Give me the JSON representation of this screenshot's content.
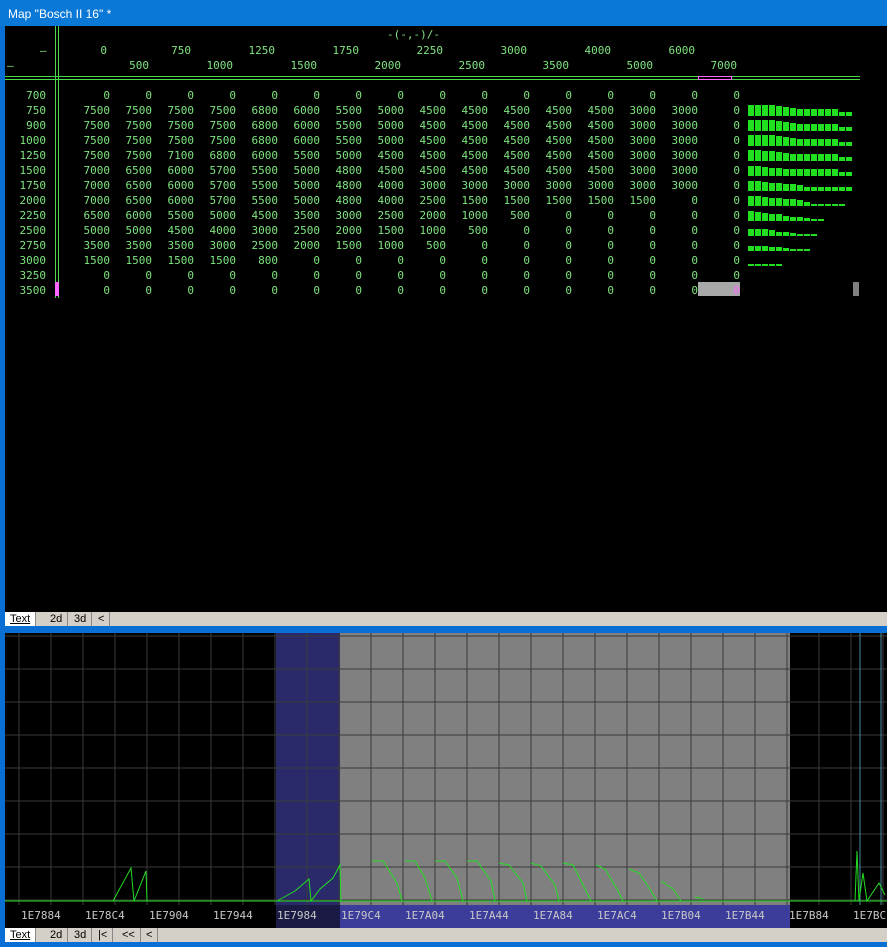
{
  "window": {
    "title": "Map \"Bosch II 16\" *"
  },
  "map": {
    "axis_label": "-(-,-)/-",
    "corner_top": "–",
    "corner_bottom": "–",
    "x_axis": [
      "0",
      "500",
      "750",
      "1000",
      "1250",
      "1500",
      "1750",
      "2000",
      "2250",
      "2500",
      "3000",
      "3500",
      "4000",
      "5000",
      "6000",
      "7000"
    ],
    "y_axis": [
      "700",
      "750",
      "900",
      "1000",
      "1250",
      "1500",
      "1750",
      "2000",
      "2250",
      "2500",
      "2750",
      "3000",
      "3250",
      "3500"
    ],
    "rows": [
      [
        "0",
        "0",
        "0",
        "0",
        "0",
        "0",
        "0",
        "0",
        "0",
        "0",
        "0",
        "0",
        "0",
        "0",
        "0",
        "0"
      ],
      [
        "7500",
        "7500",
        "7500",
        "7500",
        "6800",
        "6000",
        "5500",
        "5000",
        "4500",
        "4500",
        "4500",
        "4500",
        "4500",
        "3000",
        "3000",
        "0"
      ],
      [
        "7500",
        "7500",
        "7500",
        "7500",
        "6800",
        "6000",
        "5500",
        "5000",
        "4500",
        "4500",
        "4500",
        "4500",
        "4500",
        "3000",
        "3000",
        "0"
      ],
      [
        "7500",
        "7500",
        "7500",
        "7500",
        "6800",
        "6000",
        "5500",
        "5000",
        "4500",
        "4500",
        "4500",
        "4500",
        "4500",
        "3000",
        "3000",
        "0"
      ],
      [
        "7500",
        "7500",
        "7100",
        "6800",
        "6000",
        "5500",
        "5000",
        "4500",
        "4500",
        "4500",
        "4500",
        "4500",
        "4500",
        "3000",
        "3000",
        "0"
      ],
      [
        "7000",
        "6500",
        "6000",
        "5700",
        "5500",
        "5000",
        "4800",
        "4500",
        "4500",
        "4500",
        "4500",
        "4500",
        "4500",
        "3000",
        "3000",
        "0"
      ],
      [
        "7000",
        "6500",
        "6000",
        "5700",
        "5500",
        "5000",
        "4800",
        "4000",
        "3000",
        "3000",
        "3000",
        "3000",
        "3000",
        "3000",
        "3000",
        "0"
      ],
      [
        "7000",
        "6500",
        "6000",
        "5700",
        "5500",
        "5000",
        "4800",
        "4000",
        "2500",
        "1500",
        "1500",
        "1500",
        "1500",
        "1500",
        "0",
        "0"
      ],
      [
        "6500",
        "6000",
        "5500",
        "5000",
        "4500",
        "3500",
        "3000",
        "2500",
        "2000",
        "1000",
        "500",
        "0",
        "0",
        "0",
        "0",
        "0"
      ],
      [
        "5000",
        "5000",
        "4500",
        "4000",
        "3000",
        "2500",
        "2000",
        "1500",
        "1000",
        "500",
        "0",
        "0",
        "0",
        "0",
        "0",
        "0"
      ],
      [
        "3500",
        "3500",
        "3500",
        "3000",
        "2500",
        "2000",
        "1500",
        "1000",
        "500",
        "0",
        "0",
        "0",
        "0",
        "0",
        "0",
        "0"
      ],
      [
        "1500",
        "1500",
        "1500",
        "1500",
        "800",
        "0",
        "0",
        "0",
        "0",
        "0",
        "0",
        "0",
        "0",
        "0",
        "0",
        "0"
      ],
      [
        "0",
        "0",
        "0",
        "0",
        "0",
        "0",
        "0",
        "0",
        "0",
        "0",
        "0",
        "0",
        "0",
        "0",
        "0",
        "0"
      ],
      [
        "0",
        "0",
        "0",
        "0",
        "0",
        "0",
        "0",
        "0",
        "0",
        "0",
        "0",
        "0",
        "0",
        "0",
        "0",
        "0"
      ]
    ],
    "max_value": 7500,
    "colors": {
      "text": "#7fe47f",
      "bar": "#20e020",
      "grid_line": "#4bd84b",
      "cursor": "#ff66ff"
    }
  },
  "top_tabs": [
    "Text",
    "2d",
    "3d",
    "<"
  ],
  "hex": {
    "addresses": [
      "1E7884",
      "1E78C4",
      "1E7904",
      "1E7944",
      "1E7984",
      "1E79C4",
      "1E7A04",
      "1E7A44",
      "1E7A84",
      "1E7AC4",
      "1E7B04",
      "1E7B44",
      "1E7B84",
      "1E7BC"
    ],
    "colors": {
      "selection": "#808080",
      "highlight": "#2a2a6a",
      "trace": "#22dd22",
      "grid": "#3a3a3a"
    }
  },
  "bottom_tabs": [
    "Text",
    "2d",
    "3d",
    "|<",
    "<<",
    "<"
  ]
}
